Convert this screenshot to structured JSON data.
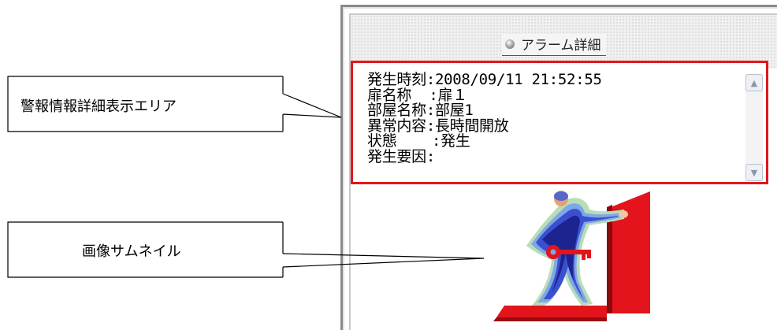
{
  "callouts": {
    "detail_area_label": "警報情報詳細表示エリア",
    "thumbnail_label": "画像サムネイル"
  },
  "panel": {
    "title": "アラーム詳細",
    "details": [
      {
        "label": "発生時刻",
        "sep": ":",
        "value": "2008/09/11 21:52:55"
      },
      {
        "label": "扉名称  ",
        "sep": ":",
        "value": "扉１"
      },
      {
        "label": "部屋名称",
        "sep": ":",
        "value": "部屋1"
      },
      {
        "label": "異常内容",
        "sep": ":",
        "value": "長時間開放"
      },
      {
        "label": "状態    ",
        "sep": ":",
        "value": "発生"
      },
      {
        "label": "発生要因",
        "sep": ":",
        "value": ""
      }
    ]
  },
  "icons": {
    "scroll_up": "chevron-up-icon",
    "scroll_down": "chevron-down-icon",
    "title_bullet": "circle-bullet-icon",
    "thumbnail": "person-with-key-at-door-illustration"
  },
  "colors": {
    "highlight_border": "#e0171d",
    "door_red": "#e3141b",
    "figure_blue": "#2233b8"
  }
}
